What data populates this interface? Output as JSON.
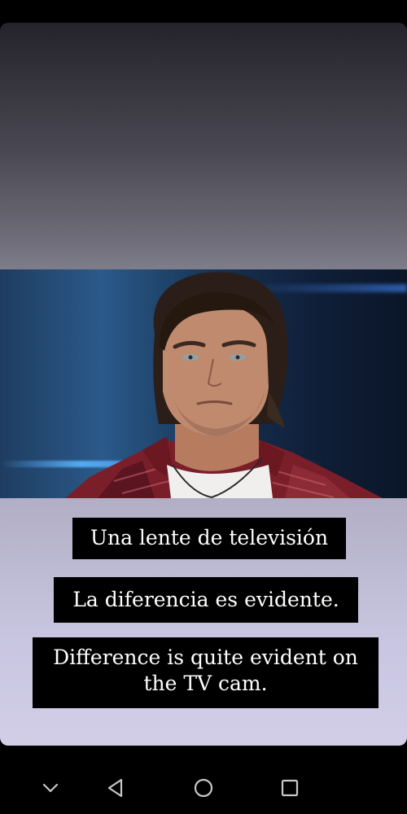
{
  "story": {
    "caption_lines": [
      "Una lente de televisión",
      "La diferencia es evidente.",
      "Difference is quite evident on the TV cam."
    ],
    "photo": {
      "subject": "man-portrait-photo",
      "background_color": "#1f3c60"
    }
  },
  "navigation": {
    "buttons": [
      {
        "icon": "chevron-down-icon"
      },
      {
        "icon": "back-triangle-icon"
      },
      {
        "icon": "home-circle-icon"
      },
      {
        "icon": "recents-square-icon"
      }
    ]
  },
  "colors": {
    "gradient_top": "#24232c",
    "gradient_bottom": "#d2cee8",
    "caption_bg": "#000000",
    "caption_text": "#ffffff"
  }
}
